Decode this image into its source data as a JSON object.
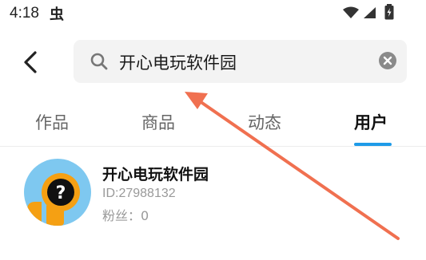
{
  "status_bar": {
    "time": "4:18",
    "app_icon_glyph": "虫",
    "icons": [
      "wifi-icon",
      "signal-icon",
      "battery-icon"
    ]
  },
  "header": {
    "back_icon": "back-arrow-icon",
    "search_query": "开心电玩软件园",
    "search_icon": "search-icon",
    "clear_icon": "clear-icon"
  },
  "tabs": [
    {
      "label": "作品",
      "active": false
    },
    {
      "label": "商品",
      "active": false
    },
    {
      "label": "动态",
      "active": false
    },
    {
      "label": "用户",
      "active": true
    }
  ],
  "results": [
    {
      "name": "开心电玩软件园",
      "id_text": "ID:27988132",
      "fans_text": "粉丝：0",
      "avatar_icon": "question-avatar-icon"
    }
  ],
  "colors": {
    "accent": "#1e9be8",
    "annotation_arrow": "#f07050",
    "avatar_bg": "#7ec8f0",
    "avatar_figure": "#f5a013"
  }
}
